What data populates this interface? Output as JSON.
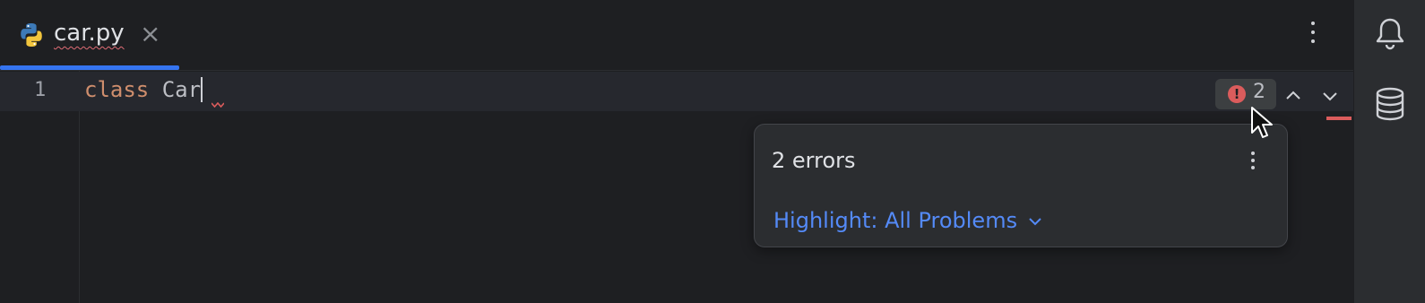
{
  "tab": {
    "filename": "car.py",
    "close_glyph": "×",
    "icon": "python-file-icon"
  },
  "editor": {
    "line_number": "1",
    "code_keyword": "class",
    "code_identifier": "Car"
  },
  "inspection": {
    "error_count": "2"
  },
  "popup": {
    "title": "2 errors",
    "highlight_link": "Highlight: All Problems"
  },
  "right_toolbar": {
    "icons": [
      "notifications-bell-icon",
      "database-icon"
    ]
  },
  "colors": {
    "background": "#1e1f22",
    "accent": "#3574f0",
    "error": "#db5c5c",
    "keyword": "#cf8e6d",
    "link": "#548af7"
  }
}
